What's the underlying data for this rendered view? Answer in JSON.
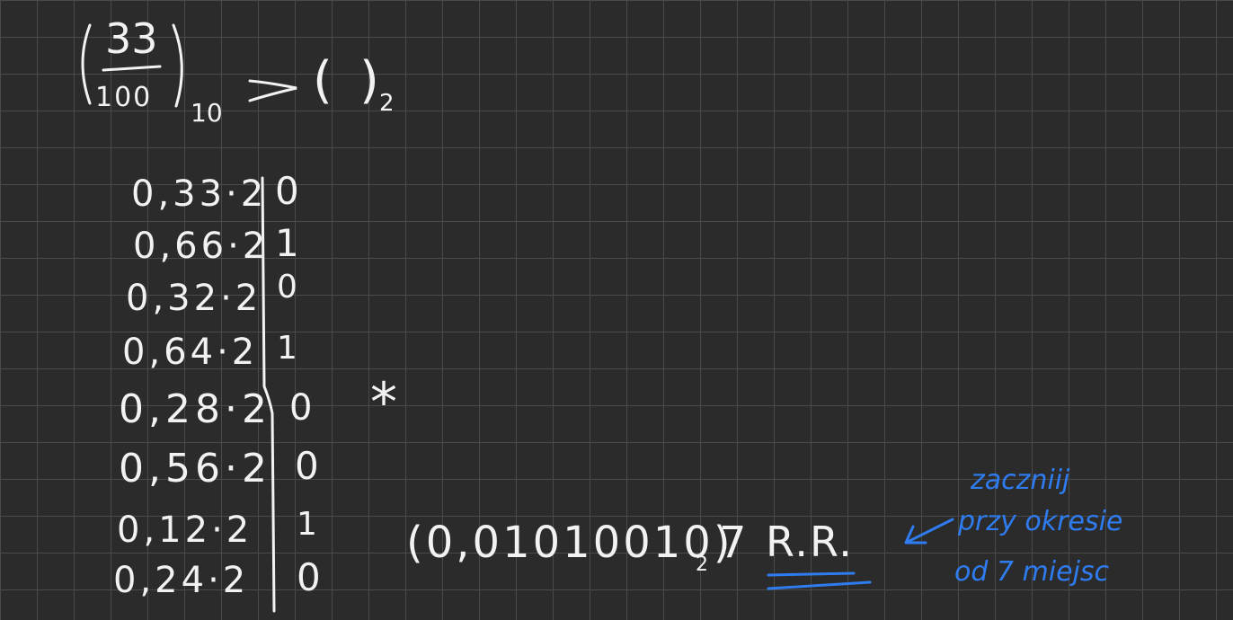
{
  "header": {
    "numerator": "33",
    "denominator": "100",
    "base_from": "10",
    "arrow": "→",
    "open_paren": "(",
    "close_paren": ")",
    "base_to": "2"
  },
  "rows": [
    {
      "expr": "0,33·2",
      "bit": "0"
    },
    {
      "expr": "0,66·2",
      "bit": "1"
    },
    {
      "expr": "0,32·2",
      "bit": "0"
    },
    {
      "expr": "0,64·2",
      "bit": "1"
    },
    {
      "expr": "0,28·2",
      "bit": "0"
    },
    {
      "expr": "0,56·2",
      "bit": "0"
    },
    {
      "expr": "0,12·2",
      "bit": "1"
    },
    {
      "expr": "0,24·2",
      "bit": "0"
    }
  ],
  "star": "*",
  "result": {
    "value": "(0,01010010)",
    "base": "2",
    "approx": "7",
    "rr": "R.R."
  },
  "note": {
    "line1": "zaczniij",
    "line2": "przy okresie",
    "line3": "od 7 miejsc"
  },
  "colors": {
    "background": "#2b2b2b",
    "grid": "#4a4a4a",
    "ink": "#f2f2f2",
    "accent": "#2e7cf0"
  }
}
